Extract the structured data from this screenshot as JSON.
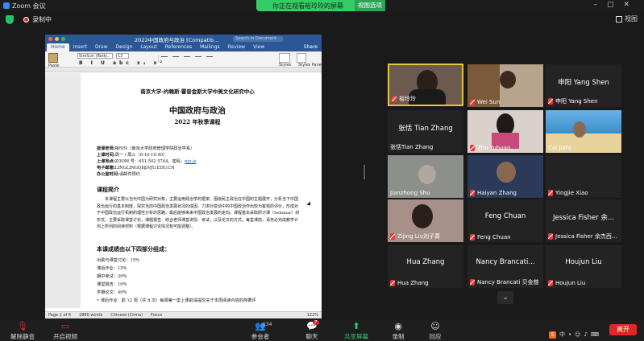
{
  "window": {
    "title": "Zoom 会议"
  },
  "share_banner": {
    "text": "你正在观看裕玲玲的屏幕",
    "view_options": "视图选项"
  },
  "info": {
    "recording": "录制中",
    "view": "视图"
  },
  "word": {
    "doc_title": "2022中国政府与政治 [Compatib...",
    "search_placeholder": "Search in Document",
    "tabs": [
      "Home",
      "Insert",
      "Draw",
      "Design",
      "Layout",
      "References",
      "Mailings",
      "Review",
      "View"
    ],
    "share": "Share",
    "paste_label": "Paste",
    "font": "SimSun (Body...",
    "size": "12",
    "format_buttons": "B I U abc x₂ x²",
    "styles_label": "Styles",
    "styles_pane_label": "Styles Pane",
    "status": {
      "page": "Page 1 of 6",
      "words": "2880 words",
      "lang": "Chinese (China)",
      "focus": "Focus",
      "zoom": "122%"
    },
    "page": {
      "university": "南京大学-约翰斯·霍普金斯大学中美文化研究中心",
      "title": "中国政府与政治",
      "subtitle": "2022 年秋季课程",
      "info_lines": [
        {
          "k": "授课老师:",
          "v": "裕玲玲（南京大学政府管理学院政治学系）"
        },
        {
          "k": "上课时间:",
          "v": "周一 / 周三（9:10-10:40）"
        },
        {
          "k": "上课地点:",
          "v": "ZOOM 号：651 502 5744。密码：",
          "link": "nju.js"
        },
        {
          "k": "电子邮箱:",
          "v": "LINGLINGQI@NJU.EDU.CN"
        },
        {
          "k": "办公室时间:",
          "v": "请邮件预约"
        }
      ],
      "intro_heading": "课程简介",
      "intro_text": "本课程主要以当代中国为研究对象，主要运用政治学的框架，围绕民主政治在中国的主题展开，分析当下中国政治运行的基本制度，探究当前中国政治发展状况的成因。力求对变动中的中国政治作出较为客观的评价，形成对于中国政治运行机制的理性分析的思路，最后能够来来中国政治发展的走向。课程基本采取研讨课（Seminar）的形式，主要采取课堂讨论，课题报告、结合老师课堂讲授、考试，以及论文的方式，每堂课前，请务必完成教学计划上所列的阅读材料（根据课程讨论情况有可能调整）。",
      "grade_heading": "本课成绩由以下四部分组成：",
      "grade_items": [
        "出勤与课堂讨论：15%",
        "课后作业：15%",
        "期中考试：20%",
        "课堂报告：10%",
        "学期论文：40%",
        "• 课后作业：前 12 周（共 8 次）每周第一堂上课前请提交关于本周阅读内容的简要评"
      ]
    }
  },
  "participants": [
    {
      "label": "裕玲玲",
      "active": true
    },
    {
      "label": "Wei Sun",
      "active": false
    },
    {
      "name": "申阳 Yang Shen",
      "label": "申阳 Yang Shen"
    },
    {
      "name": "张恬 Tian  Zhang",
      "label": "张恬Tian Zhang"
    },
    {
      "label": "Zhu Yuhuan"
    },
    {
      "label": "Cai Jiafa"
    },
    {
      "label": "Jianzhong Shu"
    },
    {
      "label": "Haiyan Zhang"
    },
    {
      "label": "Yingjie Xiao"
    },
    {
      "label": "Zijing Liu刘子菁"
    },
    {
      "name": "Feng Chuan",
      "label": "Feng Chuan"
    },
    {
      "name": "Jessica Fisher 余...",
      "label": "Jessica Fisher 余杰西..."
    },
    {
      "name": "Hua Zhang",
      "label": "Hua Zhang"
    },
    {
      "name": "Nancy Brancati...",
      "label": "Nancy Brancati 贝金慈"
    },
    {
      "name": "Houjun Liu",
      "label": "Houjun Liu"
    }
  ],
  "toolbar": {
    "unmute": "解除静音",
    "start_video": "开启视频",
    "participants": "参会者",
    "participants_count": "134",
    "chat": "聊天",
    "chat_badge": "7",
    "share": "共享屏幕",
    "record": "录制",
    "reactions": "回应",
    "end": "离开"
  },
  "ime": {
    "cn": "中"
  },
  "colors": {
    "share_green": "#33cc66",
    "end_red": "#e02828",
    "word_blue": "#2b5797",
    "active_border": "#e2c93b"
  }
}
